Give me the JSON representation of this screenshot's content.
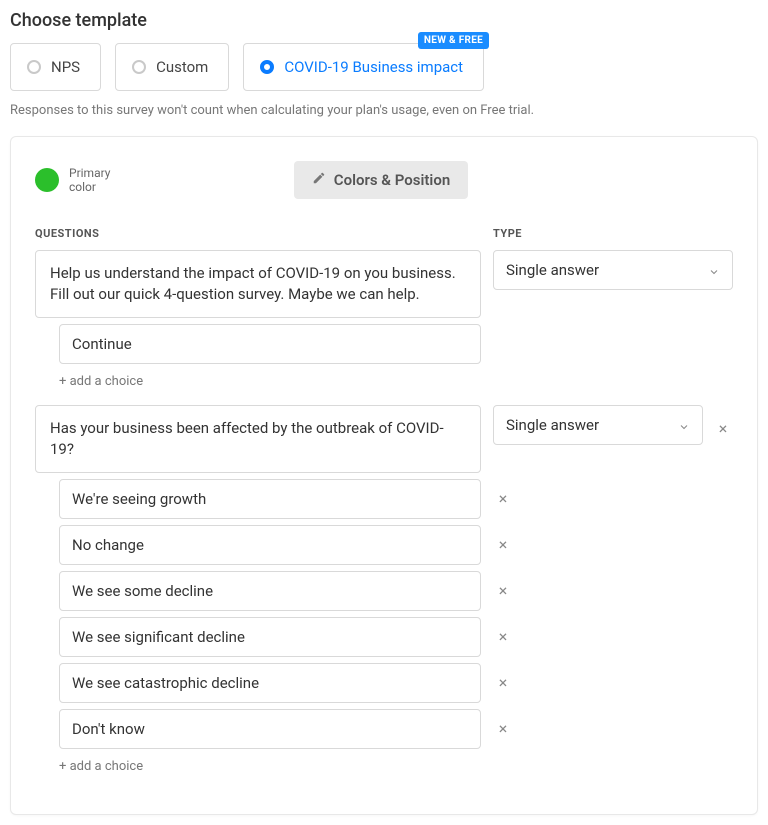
{
  "heading": "Choose template",
  "templates": {
    "nps": "NPS",
    "custom": "Custom",
    "covid": "COVID-19 Business impact",
    "badge": "NEW & FREE"
  },
  "note": "Responses to this survey won't count when calculating your plan's usage, even on Free trial.",
  "panel": {
    "primary_color_label": "Primary color",
    "colors_btn": "Colors & Position",
    "questions_title": "QUESTIONS",
    "type_title": "TYPE",
    "add_choice": "+ add a choice"
  },
  "questions": [
    {
      "text": "Help us understand the impact of COVID-19 on you business. Fill out our quick 4-question survey. Maybe we can help.",
      "type": "Single answer",
      "removable": false,
      "choices": [
        {
          "text": "Continue",
          "removable": false
        }
      ]
    },
    {
      "text": "Has your business been affected by the outbreak of COVID-19?",
      "type": "Single answer",
      "removable": true,
      "choices": [
        {
          "text": "We're seeing growth",
          "removable": true
        },
        {
          "text": "No change",
          "removable": true
        },
        {
          "text": "We see some decline",
          "removable": true
        },
        {
          "text": "We see significant decline",
          "removable": true
        },
        {
          "text": "We see catastrophic decline",
          "removable": true
        },
        {
          "text": "Don't know",
          "removable": true
        }
      ]
    }
  ]
}
